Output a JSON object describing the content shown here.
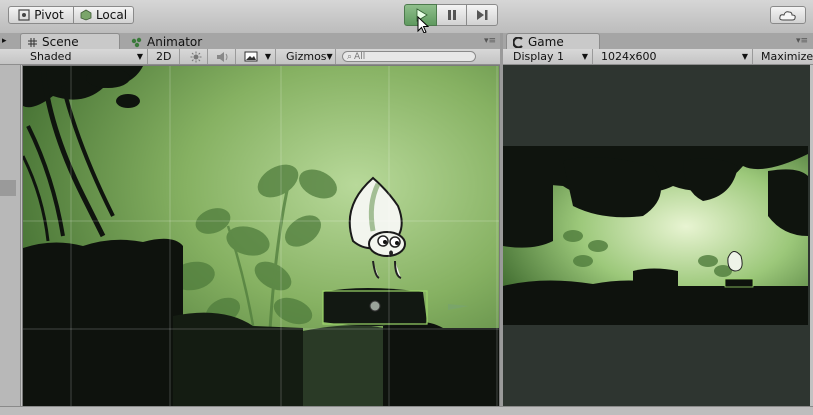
{
  "toolbar": {
    "pivot_label": "Pivot",
    "local_label": "Local"
  },
  "scene_panel": {
    "tab_scene": "Scene",
    "tab_animator": "Animator",
    "shading_mode": "Shaded",
    "mode_2d": "2D",
    "gizmos_label": "Gizmos",
    "search_placeholder": "All"
  },
  "game_panel": {
    "tab_game": "Game",
    "display": "Display 1",
    "resolution": "1024x600",
    "maximize_label": "Maximize"
  },
  "colors": {
    "scene_green": "#7ea95c",
    "play_active": "#6fa86c",
    "editor_bg": "#c2c2c2"
  },
  "icons": [
    "pivot-icon",
    "local-icon",
    "play-icon",
    "pause-icon",
    "step-icon",
    "cloud-icon",
    "scene-grid-icon",
    "animator-icon",
    "game-icon",
    "lighting-icon",
    "audio-icon",
    "image-effects-icon",
    "search-icon",
    "panel-menu-icon"
  ]
}
